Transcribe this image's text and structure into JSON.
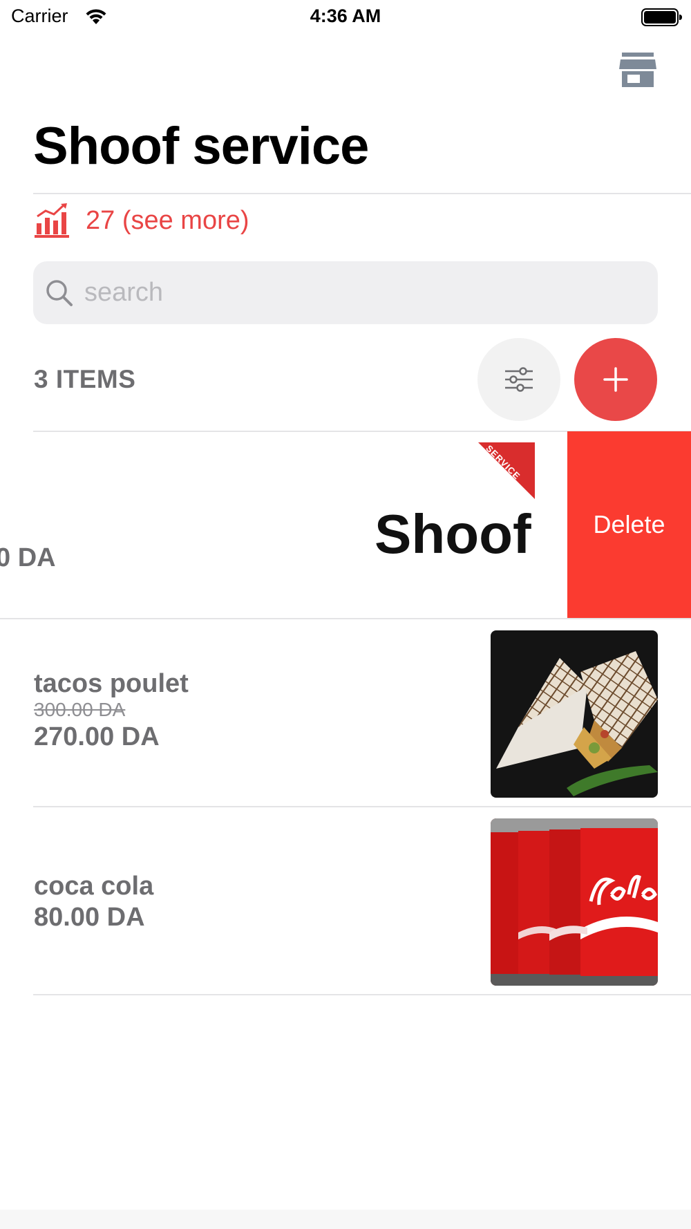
{
  "status_bar": {
    "carrier": "Carrier",
    "time": "4:36 AM"
  },
  "header": {
    "title": "Shoof service",
    "store_icon": "storefront-icon"
  },
  "stats": {
    "icon": "bar-chart-icon",
    "text": "27 (see more)"
  },
  "search": {
    "placeholder": "search",
    "value": ""
  },
  "list_header": {
    "count_label": "3 ITEMS",
    "filter_icon": "sliders-icon",
    "add_icon": "plus-icon"
  },
  "items": [
    {
      "partial_price": "0 DA",
      "delete_label": "Delete",
      "logo_text": "Shoof",
      "ribbon_text": "SERVICE"
    },
    {
      "name": "tacos poulet",
      "old_price": "300.00 DA",
      "price": "270.00 DA"
    },
    {
      "name": "coca cola",
      "price": "80.00 DA"
    }
  ],
  "colors": {
    "accent": "#e94848",
    "delete": "#fb3b30",
    "muted_text": "#6d6d70"
  }
}
